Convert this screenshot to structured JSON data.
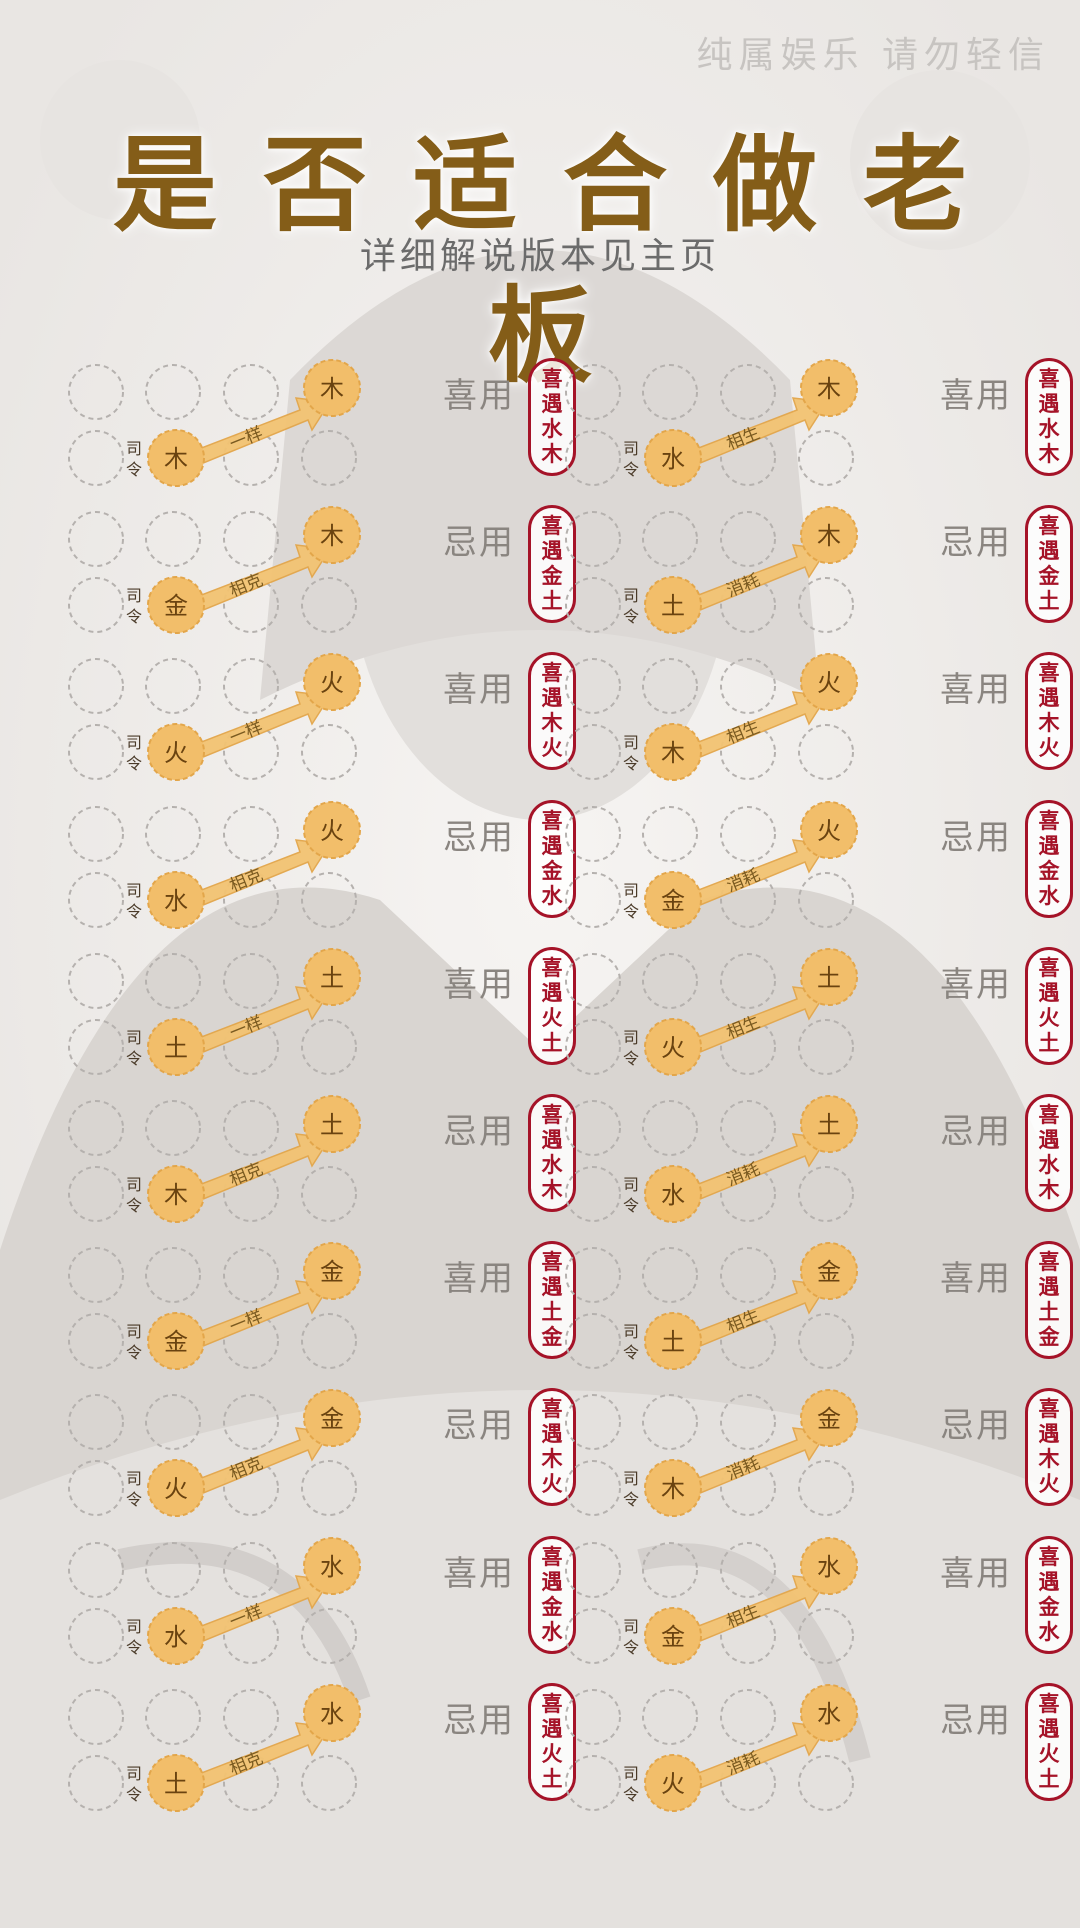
{
  "header": {
    "disclaimer": "纯属娱乐  请勿轻信",
    "title": "是否适合做老板",
    "subtitle": "详细解说版本见主页"
  },
  "commander_label": "司令",
  "colors": {
    "accent": "#845d18",
    "badge": "#a51328",
    "circle_fill": "#f2be6a",
    "arrow": "#f3c372"
  },
  "left_column": [
    {
      "source": "木",
      "relation": "一样",
      "target": "木",
      "use": "喜用",
      "badge": "喜遇水木"
    },
    {
      "source": "金",
      "relation": "相克",
      "target": "木",
      "use": "忌用",
      "badge": "喜遇金土"
    },
    {
      "source": "火",
      "relation": "一样",
      "target": "火",
      "use": "喜用",
      "badge": "喜遇木火"
    },
    {
      "source": "水",
      "relation": "相克",
      "target": "火",
      "use": "忌用",
      "badge": "喜遇金水"
    },
    {
      "source": "土",
      "relation": "一样",
      "target": "土",
      "use": "喜用",
      "badge": "喜遇火土"
    },
    {
      "source": "木",
      "relation": "相克",
      "target": "土",
      "use": "忌用",
      "badge": "喜遇水木"
    },
    {
      "source": "金",
      "relation": "一样",
      "target": "金",
      "use": "喜用",
      "badge": "喜遇土金"
    },
    {
      "source": "火",
      "relation": "相克",
      "target": "金",
      "use": "忌用",
      "badge": "喜遇木火"
    },
    {
      "source": "水",
      "relation": "一样",
      "target": "水",
      "use": "喜用",
      "badge": "喜遇金水"
    },
    {
      "source": "土",
      "relation": "相克",
      "target": "水",
      "use": "忌用",
      "badge": "喜遇火土"
    }
  ],
  "right_column": [
    {
      "source": "水",
      "relation": "相生",
      "target": "木",
      "use": "喜用",
      "badge": "喜遇水木"
    },
    {
      "source": "土",
      "relation": "消耗",
      "target": "木",
      "use": "忌用",
      "badge": "喜遇金土"
    },
    {
      "source": "木",
      "relation": "相生",
      "target": "火",
      "use": "喜用",
      "badge": "喜遇木火"
    },
    {
      "source": "金",
      "relation": "消耗",
      "target": "火",
      "use": "忌用",
      "badge": "喜遇金水"
    },
    {
      "source": "火",
      "relation": "相生",
      "target": "土",
      "use": "喜用",
      "badge": "喜遇火土"
    },
    {
      "source": "水",
      "relation": "消耗",
      "target": "土",
      "use": "忌用",
      "badge": "喜遇水木"
    },
    {
      "source": "土",
      "relation": "相生",
      "target": "金",
      "use": "喜用",
      "badge": "喜遇土金"
    },
    {
      "source": "木",
      "relation": "消耗",
      "target": "金",
      "use": "忌用",
      "badge": "喜遇木火"
    },
    {
      "source": "金",
      "relation": "相生",
      "target": "水",
      "use": "喜用",
      "badge": "喜遇金水"
    },
    {
      "source": "火",
      "relation": "消耗",
      "target": "水",
      "use": "忌用",
      "badge": "喜遇火土"
    }
  ]
}
